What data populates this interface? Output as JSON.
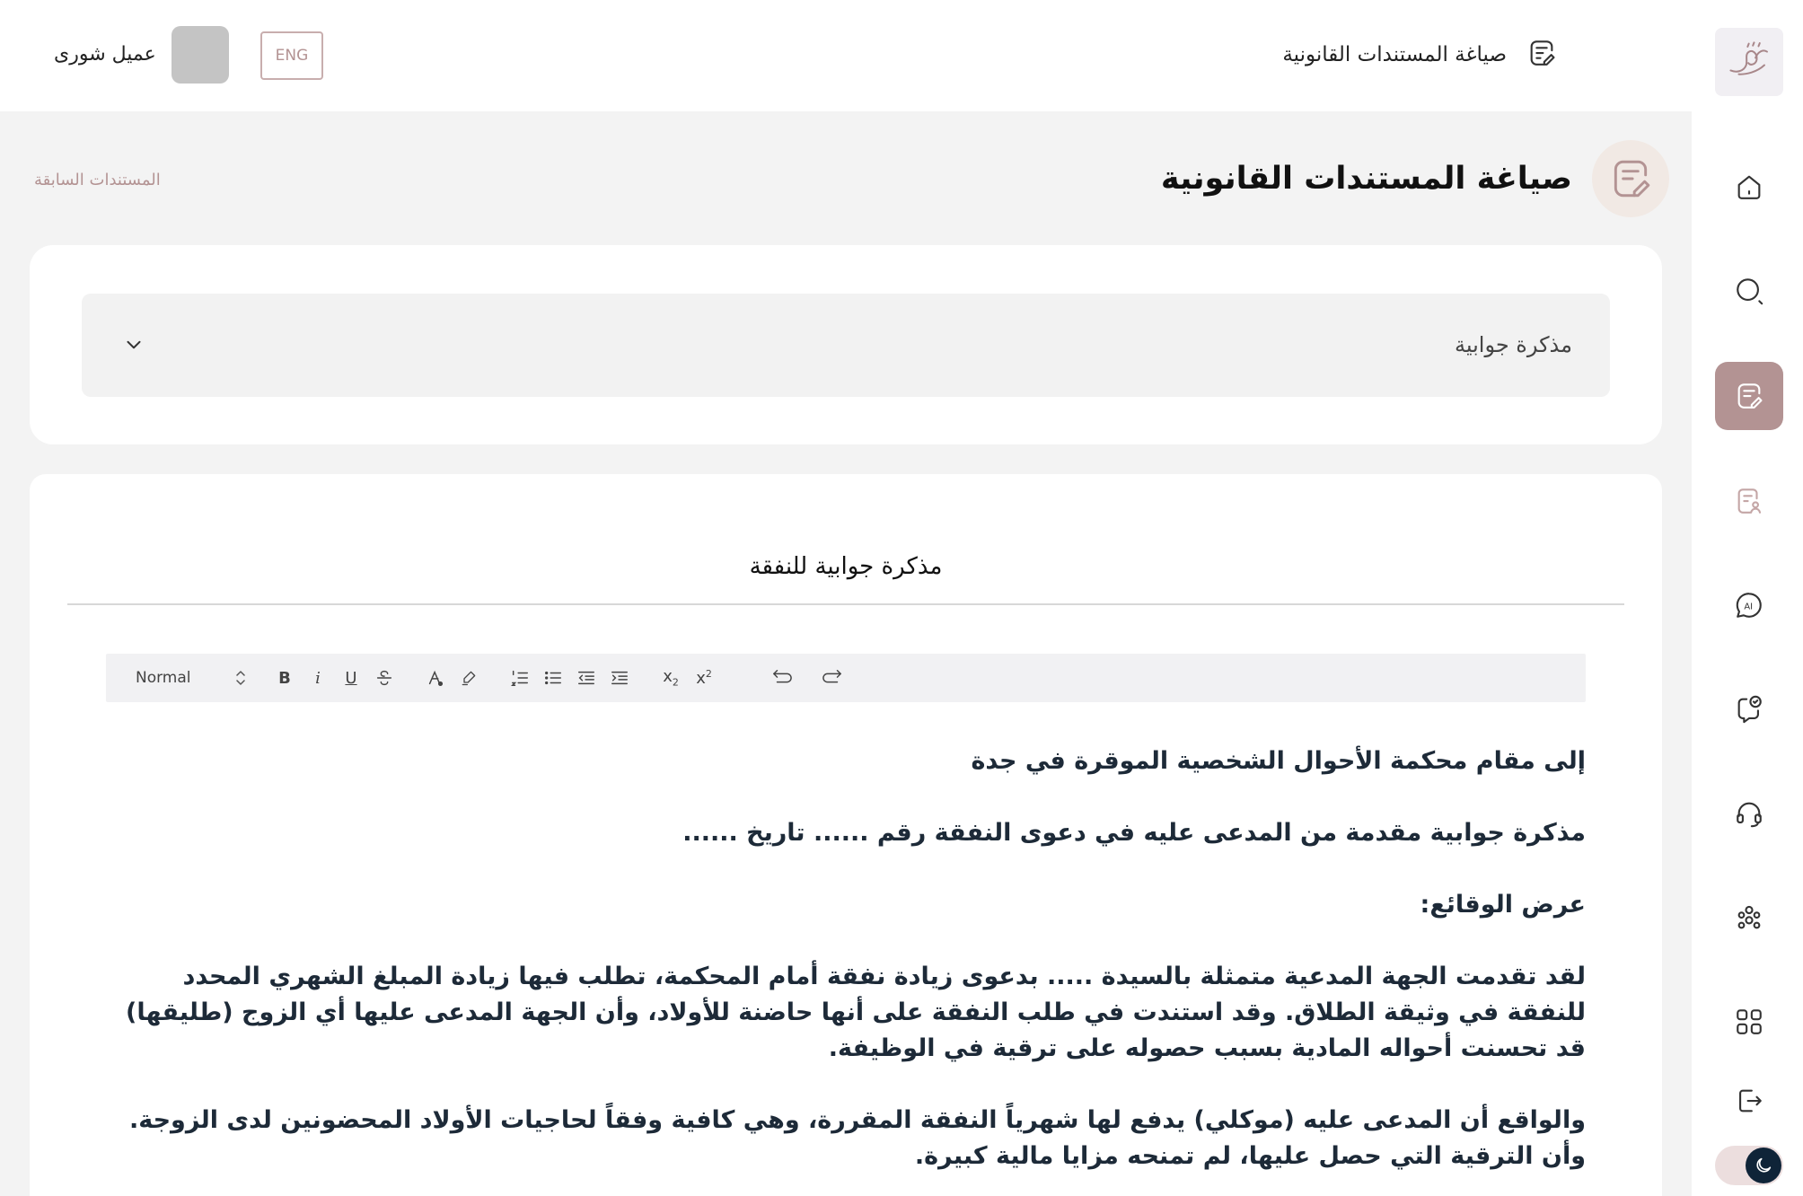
{
  "app": {
    "logo_text": "شورى"
  },
  "topbar": {
    "title": "صياغة المستندات القانونية",
    "lang_button": "ENG",
    "user_name": "عميل شورى"
  },
  "page": {
    "title": "صياغة المستندات القانونية",
    "previous_docs_link": "المستندات السابقة"
  },
  "document_type_select": {
    "selected": "مذكرة جوابية"
  },
  "editor": {
    "document_title": "مذكرة جوابية للنفقة",
    "toolbar": {
      "format_select": "Normal",
      "bold": "B",
      "italic": "i",
      "underline": "U"
    },
    "paragraphs": [
      "إلى مقام محكمة الأحوال الشخصية الموقرة في جدة",
      "مذكرة جوابية مقدمة من المدعى عليه في دعوى النفقة رقم ...... تاريخ ......",
      "عرض الوقائع:",
      "لقد تقدمت الجهة المدعية متمثلة بالسيدة ..... بدعوى زيادة نفقة أمام المحكمة، تطلب فيها زيادة المبلغ الشهري المحدد للنفقة في وثيقة الطلاق. وقد استندت في طلب النفقة على أنها حاضنة للأولاد، وأن الجهة المدعى عليها أي الزوج (طليقها) قد تحسنت أحواله المادية بسبب حصوله على ترقية في الوظيفة.",
      "والواقع أن المدعى عليه (موكلي) يدفع لها شهرياً النفقة المقررة، وهي كافية وفقاً لحاجيات الأولاد المحضونين لدى الزوجة. وأن الترقية التي حصل عليها، لم تمنحه مزايا مالية كبيرة."
    ]
  },
  "sidebar": {
    "items": [
      {
        "icon": "home-icon"
      },
      {
        "icon": "search-icon"
      },
      {
        "icon": "document-edit-icon",
        "active": true
      },
      {
        "icon": "document-user-icon"
      },
      {
        "icon": "ai-chat-icon"
      },
      {
        "icon": "consultation-check-icon"
      },
      {
        "icon": "headset-icon"
      },
      {
        "icon": "team-icon"
      },
      {
        "icon": "apps-grid-icon"
      },
      {
        "icon": "logout-icon"
      }
    ]
  },
  "colors": {
    "accent": "#b39393",
    "accent_light": "#f1e9e4",
    "text_dark": "#1d2a38",
    "toggle_knob": "#0f2438"
  }
}
